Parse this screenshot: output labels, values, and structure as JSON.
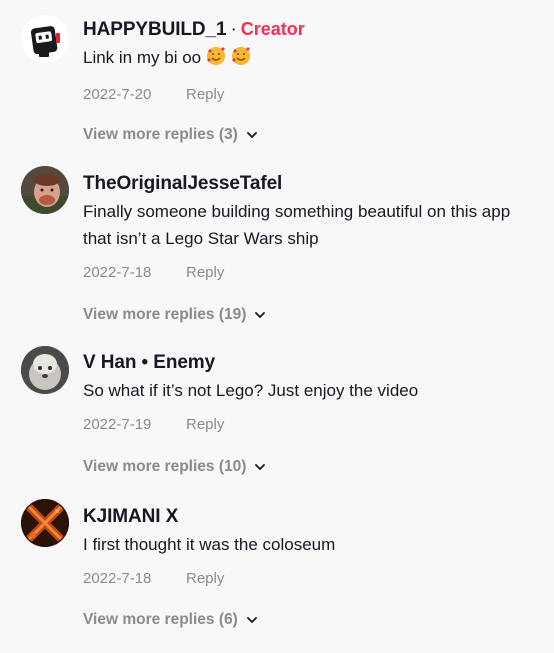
{
  "comments": [
    {
      "username": "HAPPYBUILD_1",
      "creator_sep": "·",
      "creator_badge": "Creator",
      "text": "Link in my bi oo",
      "date": "2022-7-20",
      "reply_label": "Reply",
      "view_more": "View more replies (3)",
      "avatar_icon": "robot-avatar-icon"
    },
    {
      "username": "TheOriginalJesseTafel",
      "text": "Finally someone building something beautiful on this app that isn’t a Lego Star Wars ship",
      "date": "2022-7-18",
      "reply_label": "Reply",
      "view_more": "View more replies (19)"
    },
    {
      "username": "V Han • Enemy",
      "text": "So what if it’s not Lego? Just enjoy the video",
      "date": "2022-7-19",
      "reply_label": "Reply",
      "view_more": "View more replies (10)"
    },
    {
      "username": "KJIMANI X",
      "text": "I first thought it was the coloseum",
      "date": "2022-7-18",
      "reply_label": "Reply",
      "view_more": "View more replies (6)"
    }
  ],
  "colors": {
    "creator": "#fe2c55",
    "muted": "#8a8b91",
    "text": "#161823",
    "background": "#f8f8f8"
  }
}
